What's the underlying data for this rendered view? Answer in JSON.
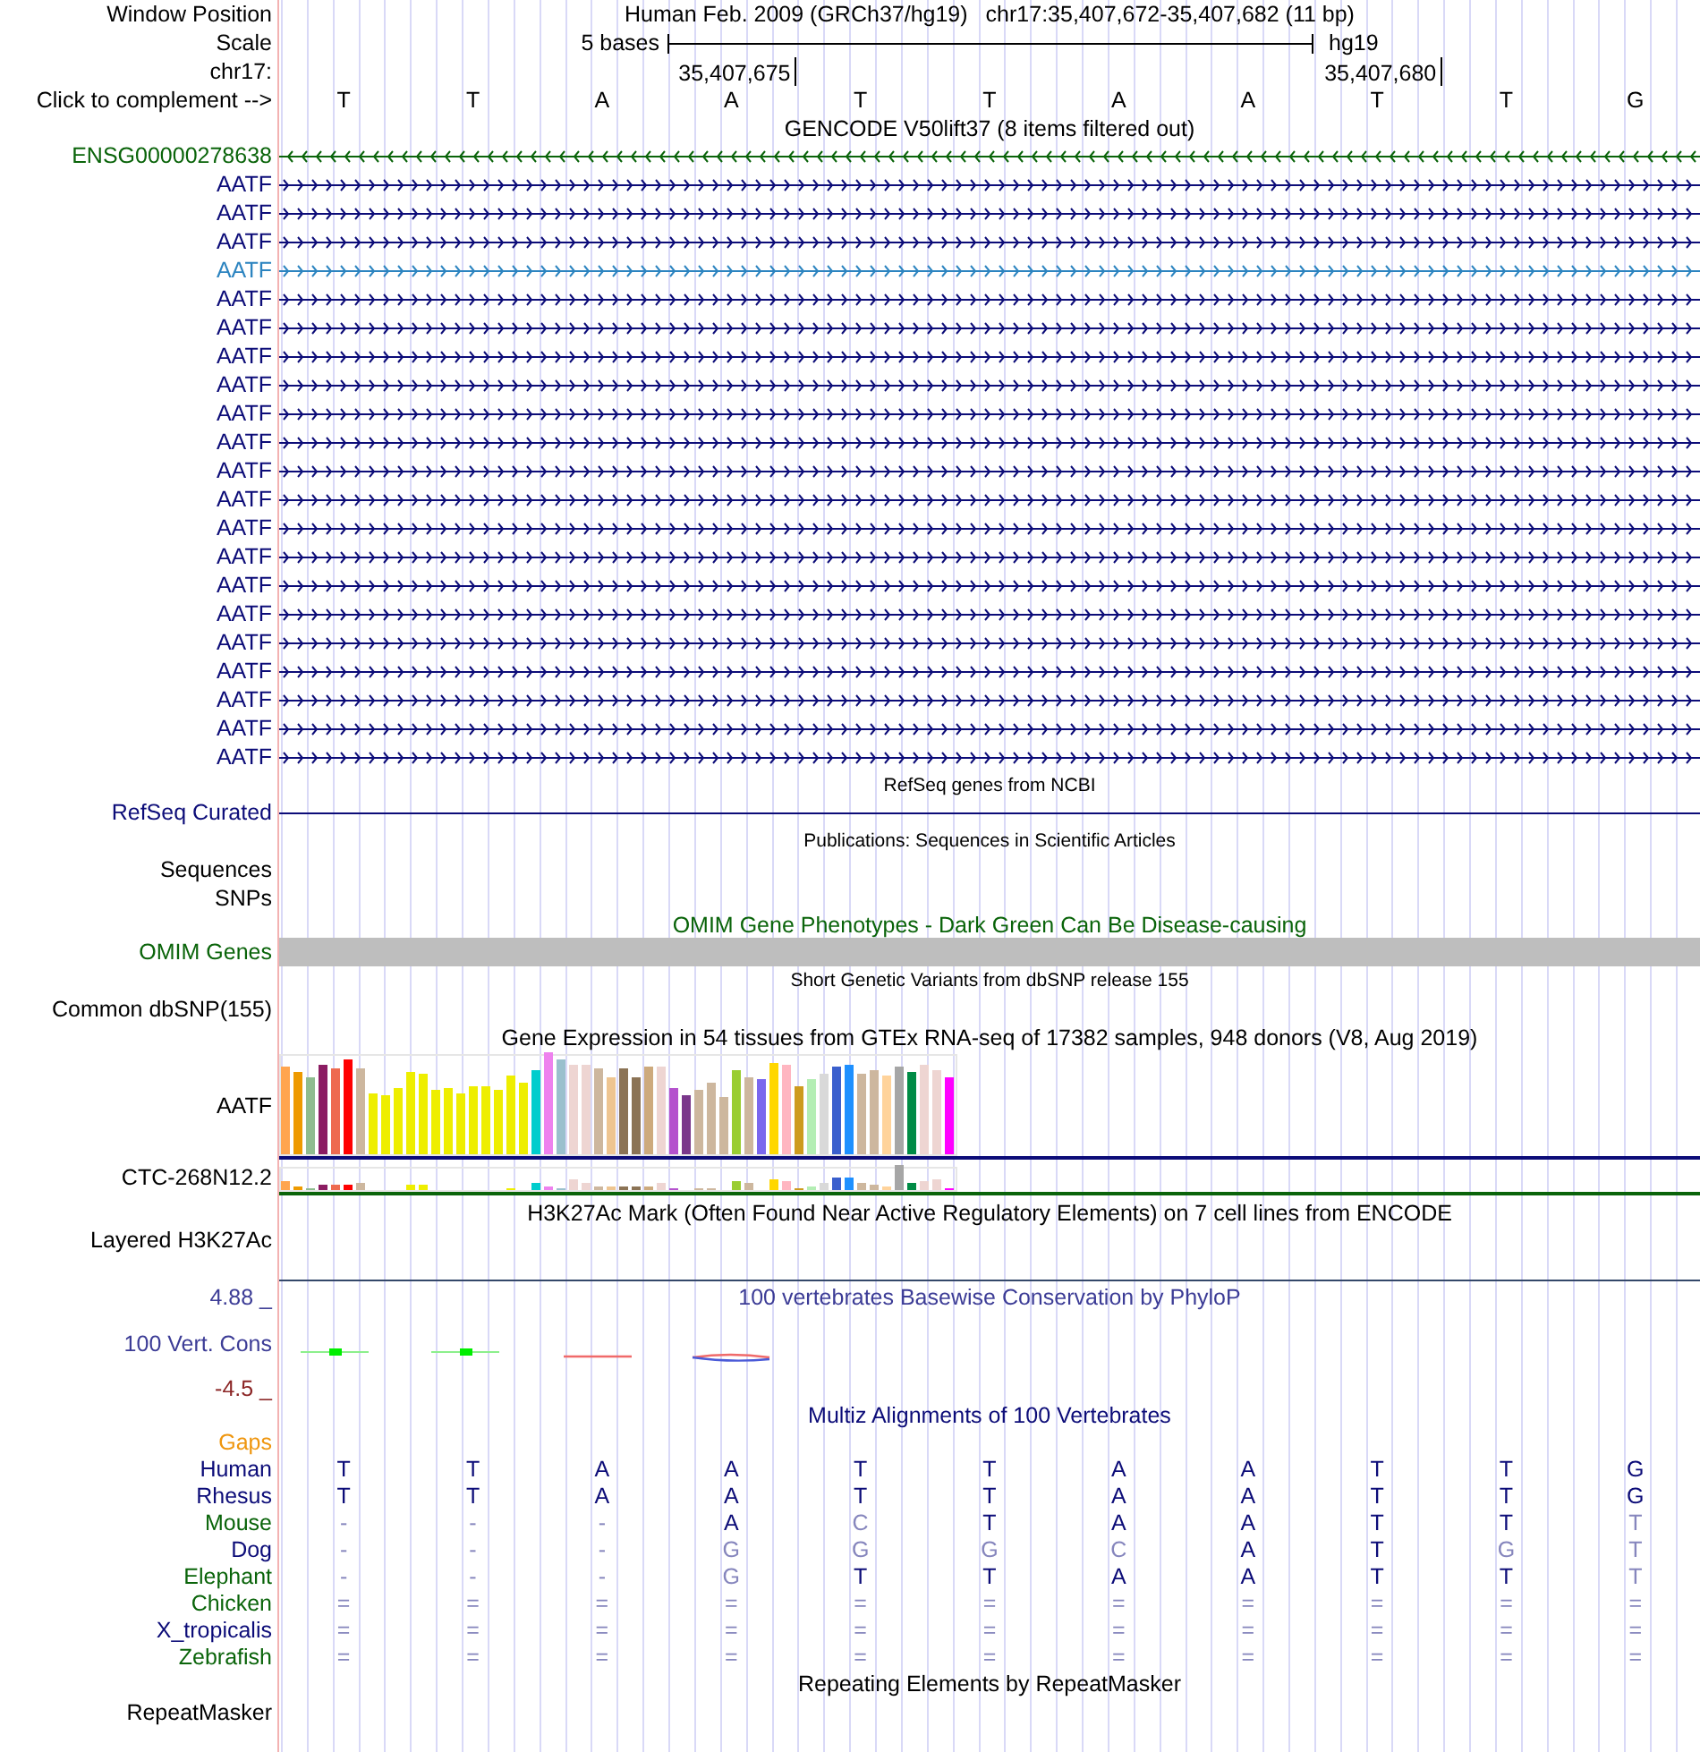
{
  "header": {
    "window_position": {
      "label": "Window Position",
      "assembly": "Human Feb. 2009 (GRCh37/hg19)",
      "range": "chr17:35,407,672-35,407,682 (11 bp)"
    },
    "scale": {
      "label": "Scale",
      "length": "5 bases",
      "assembly": "hg19"
    },
    "chromosome": {
      "label": "chr17:"
    },
    "complement": {
      "label": "Click to complement -->"
    },
    "bases": [
      {
        "letter": "T"
      },
      {
        "letter": "T"
      },
      {
        "letter": "A"
      },
      {
        "letter": "A",
        "coordinate": "35,407,675"
      },
      {
        "letter": "T"
      },
      {
        "letter": "T"
      },
      {
        "letter": "A"
      },
      {
        "letter": "A"
      },
      {
        "letter": "T",
        "coordinate": "35,407,680"
      },
      {
        "letter": "T"
      },
      {
        "letter": "G"
      }
    ]
  },
  "gencode": {
    "title": "GENCODE V50lift37 (8 items filtered out)",
    "genes": [
      {
        "name": "ENSG00000278638",
        "color": "#0a640a",
        "reverse_strand": true
      },
      {
        "name": "AATF",
        "color": "#0c0c78",
        "reverse_strand": false
      },
      {
        "name": "AATF",
        "color": "#0c0c78",
        "reverse_strand": false
      },
      {
        "name": "AATF",
        "color": "#0c0c78",
        "reverse_strand": false
      },
      {
        "name": "AATF",
        "color": "#2c84c0",
        "reverse_strand": false
      },
      {
        "name": "AATF",
        "color": "#0c0c78",
        "reverse_strand": false
      },
      {
        "name": "AATF",
        "color": "#0c0c78",
        "reverse_strand": false
      },
      {
        "name": "AATF",
        "color": "#0c0c78",
        "reverse_strand": false
      },
      {
        "name": "AATF",
        "color": "#0c0c78",
        "reverse_strand": false
      },
      {
        "name": "AATF",
        "color": "#0c0c78",
        "reverse_strand": false
      },
      {
        "name": "AATF",
        "color": "#0c0c78",
        "reverse_strand": false
      },
      {
        "name": "AATF",
        "color": "#0c0c78",
        "reverse_strand": false
      },
      {
        "name": "AATF",
        "color": "#0c0c78",
        "reverse_strand": false
      },
      {
        "name": "AATF",
        "color": "#0c0c78",
        "reverse_strand": false
      },
      {
        "name": "AATF",
        "color": "#0c0c78",
        "reverse_strand": false
      },
      {
        "name": "AATF",
        "color": "#0c0c78",
        "reverse_strand": false
      },
      {
        "name": "AATF",
        "color": "#0c0c78",
        "reverse_strand": false
      },
      {
        "name": "AATF",
        "color": "#0c0c78",
        "reverse_strand": false
      },
      {
        "name": "AATF",
        "color": "#0c0c78",
        "reverse_strand": false
      },
      {
        "name": "AATF",
        "color": "#0c0c78",
        "reverse_strand": false
      },
      {
        "name": "AATF",
        "color": "#0c0c78",
        "reverse_strand": false
      },
      {
        "name": "AATF",
        "color": "#0c0c78",
        "reverse_strand": false
      }
    ]
  },
  "refseq": {
    "title": "RefSeq genes from NCBI",
    "label": "RefSeq Curated"
  },
  "publications": {
    "title": "Publications: Sequences in Scientific Articles",
    "labels": [
      "Sequences",
      "SNPs"
    ]
  },
  "omim": {
    "title": "OMIM Gene Phenotypes - Dark Green Can Be Disease-causing",
    "label": "OMIM Genes"
  },
  "dbsnp": {
    "title": "Short Genetic Variants from dbSNP release 155",
    "label": "Common dbSNP(155)"
  },
  "gtex": {
    "title": "Gene Expression in 54 tissues from GTEx RNA-seq of 17382 samples, 948 donors (V8, Aug 2019)",
    "genes": [
      {
        "name": "AATF"
      },
      {
        "name": "CTC-268N12.2"
      }
    ]
  },
  "h3k27ac": {
    "title": "H3K27Ac Mark (Often Found Near Active Regulatory Elements) on 7 cell lines from ENCODE",
    "label": "Layered H3K27Ac"
  },
  "conservation": {
    "title": "100 vertebrates Basewise Conservation by PhyloP",
    "label": "100 Vert. Cons",
    "axis_max": "4.88 _",
    "axis_min": "-4.5 _"
  },
  "multiz": {
    "title": "Multiz Alignments of 100 Vertebrates",
    "gaps_label": "Gaps",
    "species": [
      {
        "name": "Human",
        "color": "#0c0c78",
        "bases": [
          {
            "letter": "T",
            "match": true
          },
          {
            "letter": "T",
            "match": true
          },
          {
            "letter": "A",
            "match": true
          },
          {
            "letter": "A",
            "match": true
          },
          {
            "letter": "T",
            "match": true
          },
          {
            "letter": "T",
            "match": true
          },
          {
            "letter": "A",
            "match": true
          },
          {
            "letter": "A",
            "match": true
          },
          {
            "letter": "T",
            "match": true
          },
          {
            "letter": "T",
            "match": true
          },
          {
            "letter": "G",
            "match": true
          }
        ]
      },
      {
        "name": "Rhesus",
        "color": "#0c0c78",
        "bases": [
          {
            "letter": "T",
            "match": true
          },
          {
            "letter": "T",
            "match": true
          },
          {
            "letter": "A",
            "match": true
          },
          {
            "letter": "A",
            "match": true
          },
          {
            "letter": "T",
            "match": true
          },
          {
            "letter": "T",
            "match": true
          },
          {
            "letter": "A",
            "match": true
          },
          {
            "letter": "A",
            "match": true
          },
          {
            "letter": "T",
            "match": true
          },
          {
            "letter": "T",
            "match": true
          },
          {
            "letter": "G",
            "match": true
          }
        ]
      },
      {
        "name": "Mouse",
        "color": "#0a640a",
        "bases": [
          {
            "letter": "-",
            "match": false
          },
          {
            "letter": "-",
            "match": false
          },
          {
            "letter": "-",
            "match": false
          },
          {
            "letter": "A",
            "match": true
          },
          {
            "letter": "C",
            "match": false
          },
          {
            "letter": "T",
            "match": true
          },
          {
            "letter": "A",
            "match": true
          },
          {
            "letter": "A",
            "match": true
          },
          {
            "letter": "T",
            "match": true
          },
          {
            "letter": "T",
            "match": true
          },
          {
            "letter": "T",
            "match": false
          }
        ]
      },
      {
        "name": "Dog",
        "color": "#0c0c78",
        "bases": [
          {
            "letter": "-",
            "match": false
          },
          {
            "letter": "-",
            "match": false
          },
          {
            "letter": "-",
            "match": false
          },
          {
            "letter": "G",
            "match": false
          },
          {
            "letter": "G",
            "match": false
          },
          {
            "letter": "G",
            "match": false
          },
          {
            "letter": "C",
            "match": false
          },
          {
            "letter": "A",
            "match": true
          },
          {
            "letter": "T",
            "match": true
          },
          {
            "letter": "G",
            "match": false
          },
          {
            "letter": "T",
            "match": false
          }
        ]
      },
      {
        "name": "Elephant",
        "color": "#0a640a",
        "bases": [
          {
            "letter": "-",
            "match": false
          },
          {
            "letter": "-",
            "match": false
          },
          {
            "letter": "-",
            "match": false
          },
          {
            "letter": "G",
            "match": false
          },
          {
            "letter": "T",
            "match": true
          },
          {
            "letter": "T",
            "match": true
          },
          {
            "letter": "A",
            "match": true
          },
          {
            "letter": "A",
            "match": true
          },
          {
            "letter": "T",
            "match": true
          },
          {
            "letter": "T",
            "match": true
          },
          {
            "letter": "T",
            "match": false
          }
        ]
      },
      {
        "name": "Chicken",
        "color": "#0a640a",
        "bases": [
          {
            "letter": "=",
            "match": false
          },
          {
            "letter": "=",
            "match": false
          },
          {
            "letter": "=",
            "match": false
          },
          {
            "letter": "=",
            "match": false
          },
          {
            "letter": "=",
            "match": false
          },
          {
            "letter": "=",
            "match": false
          },
          {
            "letter": "=",
            "match": false
          },
          {
            "letter": "=",
            "match": false
          },
          {
            "letter": "=",
            "match": false
          },
          {
            "letter": "=",
            "match": false
          },
          {
            "letter": "=",
            "match": false
          }
        ]
      },
      {
        "name": "X_tropicalis",
        "color": "#0c0c78",
        "bases": [
          {
            "letter": "=",
            "match": false
          },
          {
            "letter": "=",
            "match": false
          },
          {
            "letter": "=",
            "match": false
          },
          {
            "letter": "=",
            "match": false
          },
          {
            "letter": "=",
            "match": false
          },
          {
            "letter": "=",
            "match": false
          },
          {
            "letter": "=",
            "match": false
          },
          {
            "letter": "=",
            "match": false
          },
          {
            "letter": "=",
            "match": false
          },
          {
            "letter": "=",
            "match": false
          },
          {
            "letter": "=",
            "match": false
          }
        ]
      },
      {
        "name": "Zebrafish",
        "color": "#0a640a",
        "bases": [
          {
            "letter": "=",
            "match": false
          },
          {
            "letter": "=",
            "match": false
          },
          {
            "letter": "=",
            "match": false
          },
          {
            "letter": "=",
            "match": false
          },
          {
            "letter": "=",
            "match": false
          },
          {
            "letter": "=",
            "match": false
          },
          {
            "letter": "=",
            "match": false
          },
          {
            "letter": "=",
            "match": false
          },
          {
            "letter": "=",
            "match": false
          },
          {
            "letter": "=",
            "match": false
          },
          {
            "letter": "=",
            "match": false
          }
        ]
      }
    ]
  },
  "repeatmasker": {
    "title": "Repeating Elements by RepeatMasker",
    "label": "RepeatMasker"
  }
}
